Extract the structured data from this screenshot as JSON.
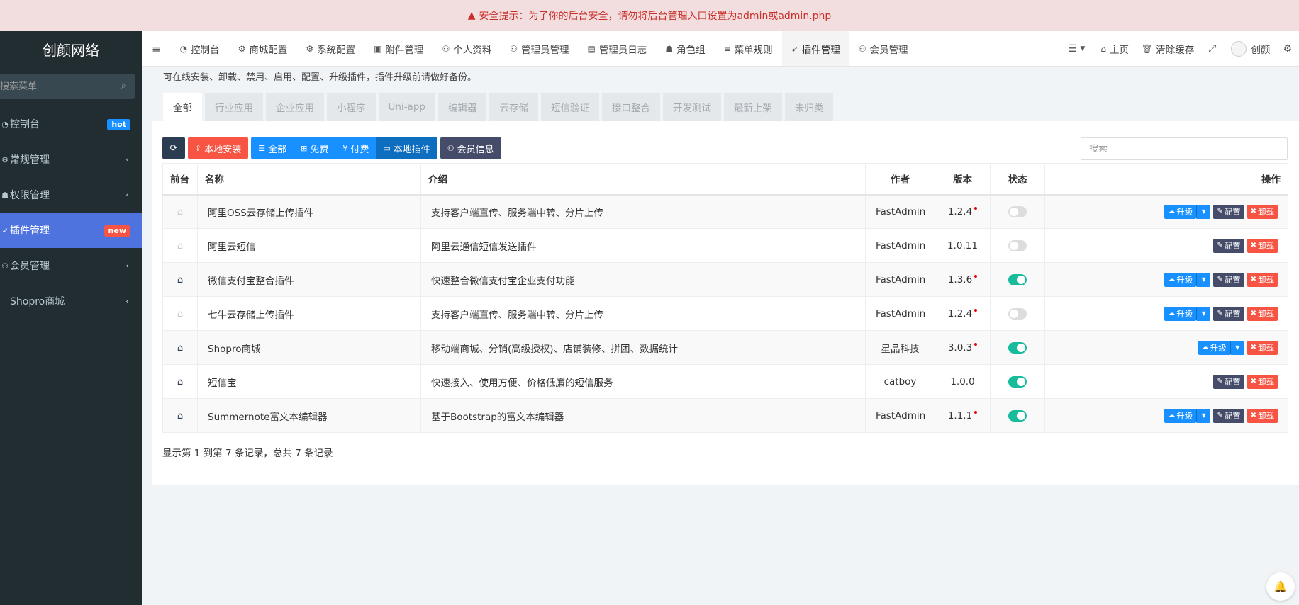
{
  "warning": {
    "text": "安全提示：为了你的后台安全，请勿将后台管理入口设置为admin或admin.php"
  },
  "sidebar": {
    "brand": "创颜网络",
    "search_placeholder": "搜索菜单",
    "items": [
      {
        "label": "控制台",
        "badge": "hot",
        "badge_color": "#1890ff"
      },
      {
        "label": "常规管理",
        "chevron": "‹"
      },
      {
        "label": "权限管理",
        "chevron": "‹"
      },
      {
        "label": "插件管理",
        "badge": "new",
        "badge_color": "#f75444"
      },
      {
        "label": "会员管理",
        "chevron": "‹"
      },
      {
        "label": "Shopro商城",
        "chevron": "‹"
      }
    ]
  },
  "topnav": {
    "items": [
      {
        "label": "控制台"
      },
      {
        "label": "商城配置"
      },
      {
        "label": "系统配置"
      },
      {
        "label": "附件管理"
      },
      {
        "label": "个人资料"
      },
      {
        "label": "管理员管理"
      },
      {
        "label": "管理员日志"
      },
      {
        "label": "角色组"
      },
      {
        "label": "菜单规则"
      },
      {
        "label": "插件管理"
      },
      {
        "label": "会员管理"
      }
    ],
    "right": {
      "home": "主页",
      "clear_cache": "清除缓存",
      "user": "创颜"
    }
  },
  "main": {
    "description": "可在线安装、卸载、禁用、启用、配置、升级插件，插件升级前请做好备份。",
    "tabs": [
      "全部",
      "行业应用",
      "企业应用",
      "小程序",
      "Uni-app",
      "编辑器",
      "云存储",
      "短信验证",
      "接口整合",
      "开发测试",
      "最新上架",
      "未归类"
    ],
    "toolbar": {
      "local_install": "本地安装",
      "filter_all": "全部",
      "filter_free": "免费",
      "filter_paid": "付费",
      "filter_local": "本地插件",
      "member_info": "会员信息"
    },
    "search_placeholder": "搜索",
    "table": {
      "headers": {
        "front": "前台",
        "name": "名称",
        "intro": "介绍",
        "author": "作者",
        "version": "版本",
        "status": "状态",
        "ops": "操作"
      },
      "rows": [
        {
          "name": "阿里OSS云存储上传插件",
          "intro": "支持客户端直传、服务端中转、分片上传",
          "author": "FastAdmin",
          "version": "1.2.4"
        },
        {
          "name": "阿里云短信",
          "intro": "阿里云通信短信发送插件",
          "author": "FastAdmin",
          "version": "1.0.11"
        },
        {
          "name": "微信支付宝整合插件",
          "intro": "快速整合微信支付宝企业支付功能",
          "author": "FastAdmin",
          "version": "1.3.6"
        },
        {
          "name": "七牛云存储上传插件",
          "intro": "支持客户端直传、服务端中转、分片上传",
          "author": "FastAdmin",
          "version": "1.2.4"
        },
        {
          "name": "Shopro商城",
          "intro": "移动端商城、分销(高级授权)、店铺装修、拼团、数据统计",
          "author": "星品科技",
          "version": "3.0.3"
        },
        {
          "name": "短信宝",
          "intro": "快速接入、使用方便、价格低廉的短信服务",
          "author": "catboy",
          "version": "1.0.0"
        },
        {
          "name": "Summernote富文本编辑器",
          "intro": "基于Bootstrap的富文本编辑器",
          "author": "FastAdmin",
          "version": "1.1.1"
        }
      ],
      "buttons": {
        "upgrade": "升级",
        "config": "配置",
        "uninstall": "卸载"
      }
    },
    "footer": "显示第 1 到第 7 条记录，总共 7 条记录"
  }
}
